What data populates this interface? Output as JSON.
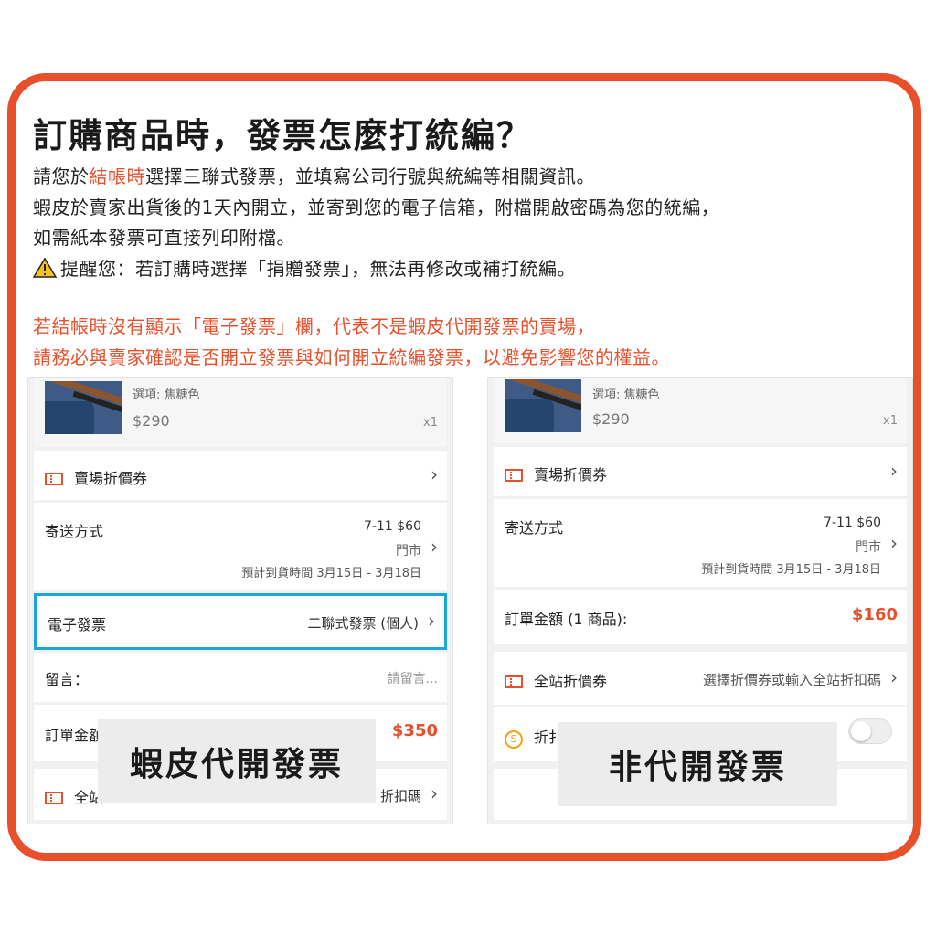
{
  "title": "訂購商品時，發票怎麼打統編？",
  "intro": {
    "line1_prefix": "請您於",
    "line1_highlight": "結帳時",
    "line1_suffix": "選擇三聯式發票，並填寫公司行號與統編等相關資訊。",
    "line2": "蝦皮於賣家出貨後的1天內開立，並寄到您的電子信箱，附檔開啟密碼為您的統編，",
    "line3": "如需紙本發票可直接列印附檔。",
    "warning": "提醒您：若訂購時選擇「捐贈發票」，無法再修改或補打統編。"
  },
  "notice": {
    "line1": "若結帳時沒有顯示「電子發票」欄，代表不是蝦皮代開發票的賣場，",
    "line2": "請務必與賣家確認是否開立發票與如何開立統編發票，以避免影響您的權益。"
  },
  "left_panel": {
    "product_option": "選項: 焦糖色",
    "product_price": "$290",
    "product_qty": "x1",
    "shop_coupon": "賣場折價券",
    "shipping_label": "寄送方式",
    "shipping_method": "7-11 $60",
    "shipping_store": "門市",
    "shipping_eta": "預計到貨時間 3月15日 - 3月18日",
    "einvoice_label": "電子發票",
    "einvoice_value": "二聯式發票 (個人)",
    "message_label": "留言：",
    "message_placeholder": "請留言...",
    "total_label": "訂單金額",
    "total_value": "$350",
    "site_coupon_label": "全站",
    "site_coupon_value": "折扣碼",
    "overlay_caption": "蝦皮代開發票"
  },
  "right_panel": {
    "product_option": "選項: 焦糖色",
    "product_price": "$290",
    "product_qty": "x1",
    "shop_coupon": "賣場折價券",
    "shipping_label": "寄送方式",
    "shipping_method": "7-11 $60",
    "shipping_store": "門市",
    "shipping_eta": "預計到貨時間 3月15日 - 3月18日",
    "total_label": "訂單金額 (1 商品):",
    "total_value": "$160",
    "site_coupon_label": "全站折價券",
    "site_coupon_value": "選擇折價券或輸入全站折扣碼",
    "coin_label": "折扌",
    "overlay_caption": "非代開發票"
  },
  "colors": {
    "accent": "#e8502c",
    "highlight_border": "#1ba6d8",
    "coin": "#f0a316"
  }
}
